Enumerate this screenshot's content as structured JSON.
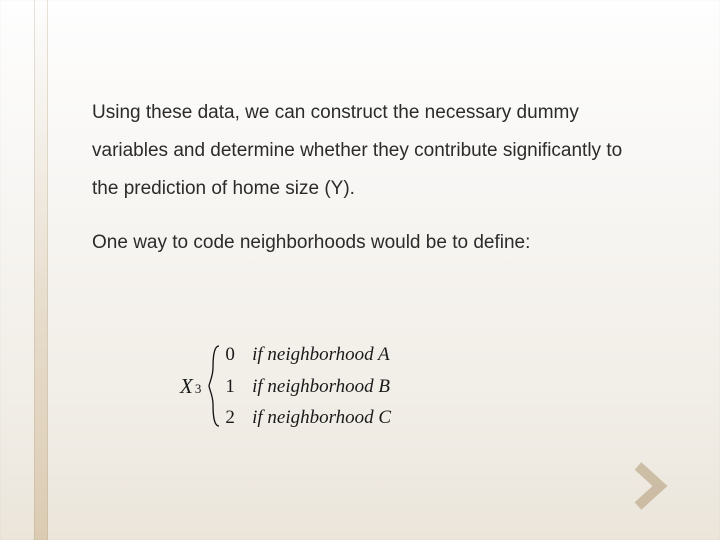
{
  "body": {
    "paragraph1": "Using these data, we can construct the necessary dummy variables and determine whether they contribute significantly to the prediction of home size (Y).",
    "paragraph2": "One way to code neighborhoods would be to define:"
  },
  "equation": {
    "variable": "X",
    "subscript": "3",
    "cases": [
      {
        "value": "0",
        "text": "if neighborhood A"
      },
      {
        "value": "1",
        "text": "if neighborhood B"
      },
      {
        "value": "2",
        "text": "if neighborhood C"
      }
    ]
  },
  "decor": {
    "chevron_icon": "chevron-right"
  }
}
